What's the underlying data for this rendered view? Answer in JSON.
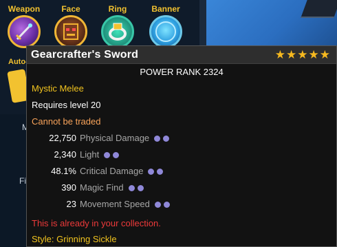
{
  "equipment_slots": [
    {
      "label": "Weapon",
      "icon": "sword-icon"
    },
    {
      "label": "Face",
      "icon": "face-icon"
    },
    {
      "label": "Ring",
      "icon": "ring-icon"
    },
    {
      "label": "Banner",
      "icon": "banner-icon"
    }
  ],
  "side": {
    "auto_label": "Auto-",
    "letter_m": "M",
    "letter_fi": "Fi"
  },
  "tooltip": {
    "title": "Gearcrafter's Sword",
    "stars": "★★★★★",
    "power_rank": "POWER RANK 2324",
    "item_type": "Mystic Melee",
    "requirement": "Requires level 20",
    "trade_status": "Cannot be traded",
    "stats": [
      {
        "value": "22,750",
        "name": "Physical Damage",
        "dots": 2
      },
      {
        "value": "2,340",
        "name": "Light",
        "dots": 2
      },
      {
        "value": "48.1%",
        "name": "Critical Damage",
        "dots": 2
      },
      {
        "value": "390",
        "name": "Magic Find",
        "dots": 2
      },
      {
        "value": "23",
        "name": "Movement Speed",
        "dots": 2
      }
    ],
    "collection_note": "This is already in your collection.",
    "style": "Style: Grinning Sickle"
  },
  "colors": {
    "gold": "#f2c41f",
    "star": "#f6b91f",
    "trade_orange": "#f8a35a",
    "warning_red": "#ee3a3a",
    "stat_dot": "#8f88d8"
  }
}
